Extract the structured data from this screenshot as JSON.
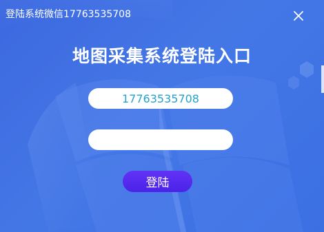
{
  "window": {
    "title": "登陆系统微信17763535708"
  },
  "icons": {
    "close": "close-icon"
  },
  "main": {
    "heading": "地图采集系统登陆入口"
  },
  "form": {
    "username_value": "17763535708",
    "password_value": "",
    "login_label": "登陆"
  },
  "colors": {
    "background": "#3f73e2",
    "field_text": "#25a2cc",
    "login_button": "#5a2cf2"
  }
}
